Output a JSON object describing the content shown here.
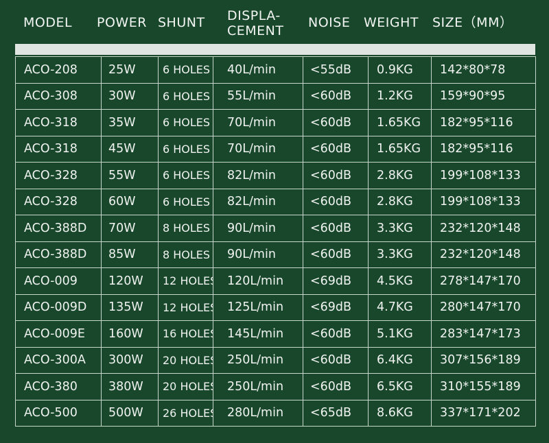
{
  "header": {
    "model": "MODEL",
    "power": "POWER",
    "shunt": "SHUNT",
    "displacement": "DISPLA-\nCEMENT",
    "noise": "NOISE",
    "weight": "WEIGHT",
    "size": "SIZE（MM）"
  },
  "rows": [
    {
      "model": "ACO-208",
      "power": "25W",
      "shunt": "6 HOLES",
      "displacement": "40L/min",
      "noise": "<55dB",
      "weight": "0.9KG",
      "size": "142*80*78"
    },
    {
      "model": "ACO-308",
      "power": "30W",
      "shunt": "6 HOLES",
      "displacement": "55L/min",
      "noise": "<60dB",
      "weight": "1.2KG",
      "size": "159*90*95"
    },
    {
      "model": "ACO-318",
      "power": "35W",
      "shunt": "6 HOLES",
      "displacement": "70L/min",
      "noise": "<60dB",
      "weight": "1.65KG",
      "size": "182*95*116"
    },
    {
      "model": "ACO-318",
      "power": "45W",
      "shunt": "6 HOLES",
      "displacement": "70L/min",
      "noise": "<60dB",
      "weight": "1.65KG",
      "size": "182*95*116"
    },
    {
      "model": "ACO-328",
      "power": "55W",
      "shunt": "6 HOLES",
      "displacement": "82L/min",
      "noise": "<60dB",
      "weight": "2.8KG",
      "size": "199*108*133"
    },
    {
      "model": "ACO-328",
      "power": "60W",
      "shunt": "6 HOLES",
      "displacement": "82L/min",
      "noise": "<60dB",
      "weight": "2.8KG",
      "size": "199*108*133"
    },
    {
      "model": "ACO-388D",
      "power": "70W",
      "shunt": "8 HOLES",
      "displacement": "90L/min",
      "noise": "<60dB",
      "weight": "3.3KG",
      "size": "232*120*148"
    },
    {
      "model": "ACO-388D",
      "power": "85W",
      "shunt": "8 HOLES",
      "displacement": "90L/min",
      "noise": "<60dB",
      "weight": "3.3KG",
      "size": "232*120*148"
    },
    {
      "model": "ACO-009",
      "power": "120W",
      "shunt": "12 HOLES",
      "displacement": "120L/min",
      "noise": "<69dB",
      "weight": "4.5KG",
      "size": "278*147*170"
    },
    {
      "model": "ACO-009D",
      "power": "135W",
      "shunt": "12 HOLES",
      "displacement": "125L/min",
      "noise": "<69dB",
      "weight": "4.7KG",
      "size": "280*147*170"
    },
    {
      "model": "ACO-009E",
      "power": "160W",
      "shunt": "16 HOLES",
      "displacement": "145L/min",
      "noise": "<60dB",
      "weight": "5.1KG",
      "size": "283*147*173"
    },
    {
      "model": "ACO-300A",
      "power": "300W",
      "shunt": "20 HOLES",
      "displacement": "250L/min",
      "noise": "<60dB",
      "weight": "6.4KG",
      "size": "307*156*189"
    },
    {
      "model": "ACO-380",
      "power": "380W",
      "shunt": "20 HOLES",
      "displacement": "250L/min",
      "noise": "<60dB",
      "weight": "6.5KG",
      "size": "310*155*189"
    },
    {
      "model": "ACO-500",
      "power": "500W",
      "shunt": "26 HOLES",
      "displacement": "280L/min",
      "noise": "<65dB",
      "weight": "8.6KG",
      "size": "337*171*202"
    }
  ]
}
